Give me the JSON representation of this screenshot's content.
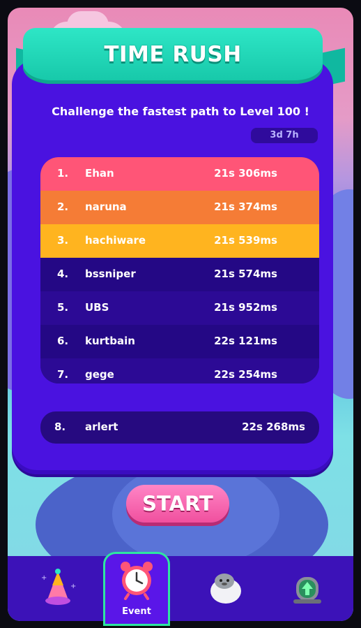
{
  "event": {
    "title": "TIME RUSH",
    "subtitle": "Challenge the fastest path to Level 100 !",
    "timer": "3d 7h"
  },
  "leaderboard": [
    {
      "rank": "1.",
      "name": "Ehan",
      "time": "21s 306ms",
      "color": "#ff5577"
    },
    {
      "rank": "2.",
      "name": "naruna",
      "time": "21s 374ms",
      "color": "#f57c36"
    },
    {
      "rank": "3.",
      "name": "hachiware",
      "time": "21s 539ms",
      "color": "#ffb41f"
    },
    {
      "rank": "4.",
      "name": "bssniper",
      "time": "21s 574ms",
      "color": "#2c0a95"
    },
    {
      "rank": "5.",
      "name": "UBS",
      "time": "21s 952ms",
      "color": "#2c0a95"
    },
    {
      "rank": "6.",
      "name": "kurtbain",
      "time": "22s 121ms",
      "color": "#2c0a95"
    },
    {
      "rank": "7.",
      "name": "gege",
      "time": "22s 254ms",
      "color": "#2c0a95"
    }
  ],
  "my_rank": {
    "rank": "8.",
    "name": "arlert",
    "time": "22s 268ms"
  },
  "start_button": "START",
  "nav": {
    "items": [
      {
        "icon": "party-hat-icon"
      },
      {
        "icon": "alarm-clock-icon",
        "label": "Event",
        "active": true
      },
      {
        "icon": "seal-mascot-icon"
      },
      {
        "icon": "upgrade-gravestone-icon"
      }
    ]
  }
}
